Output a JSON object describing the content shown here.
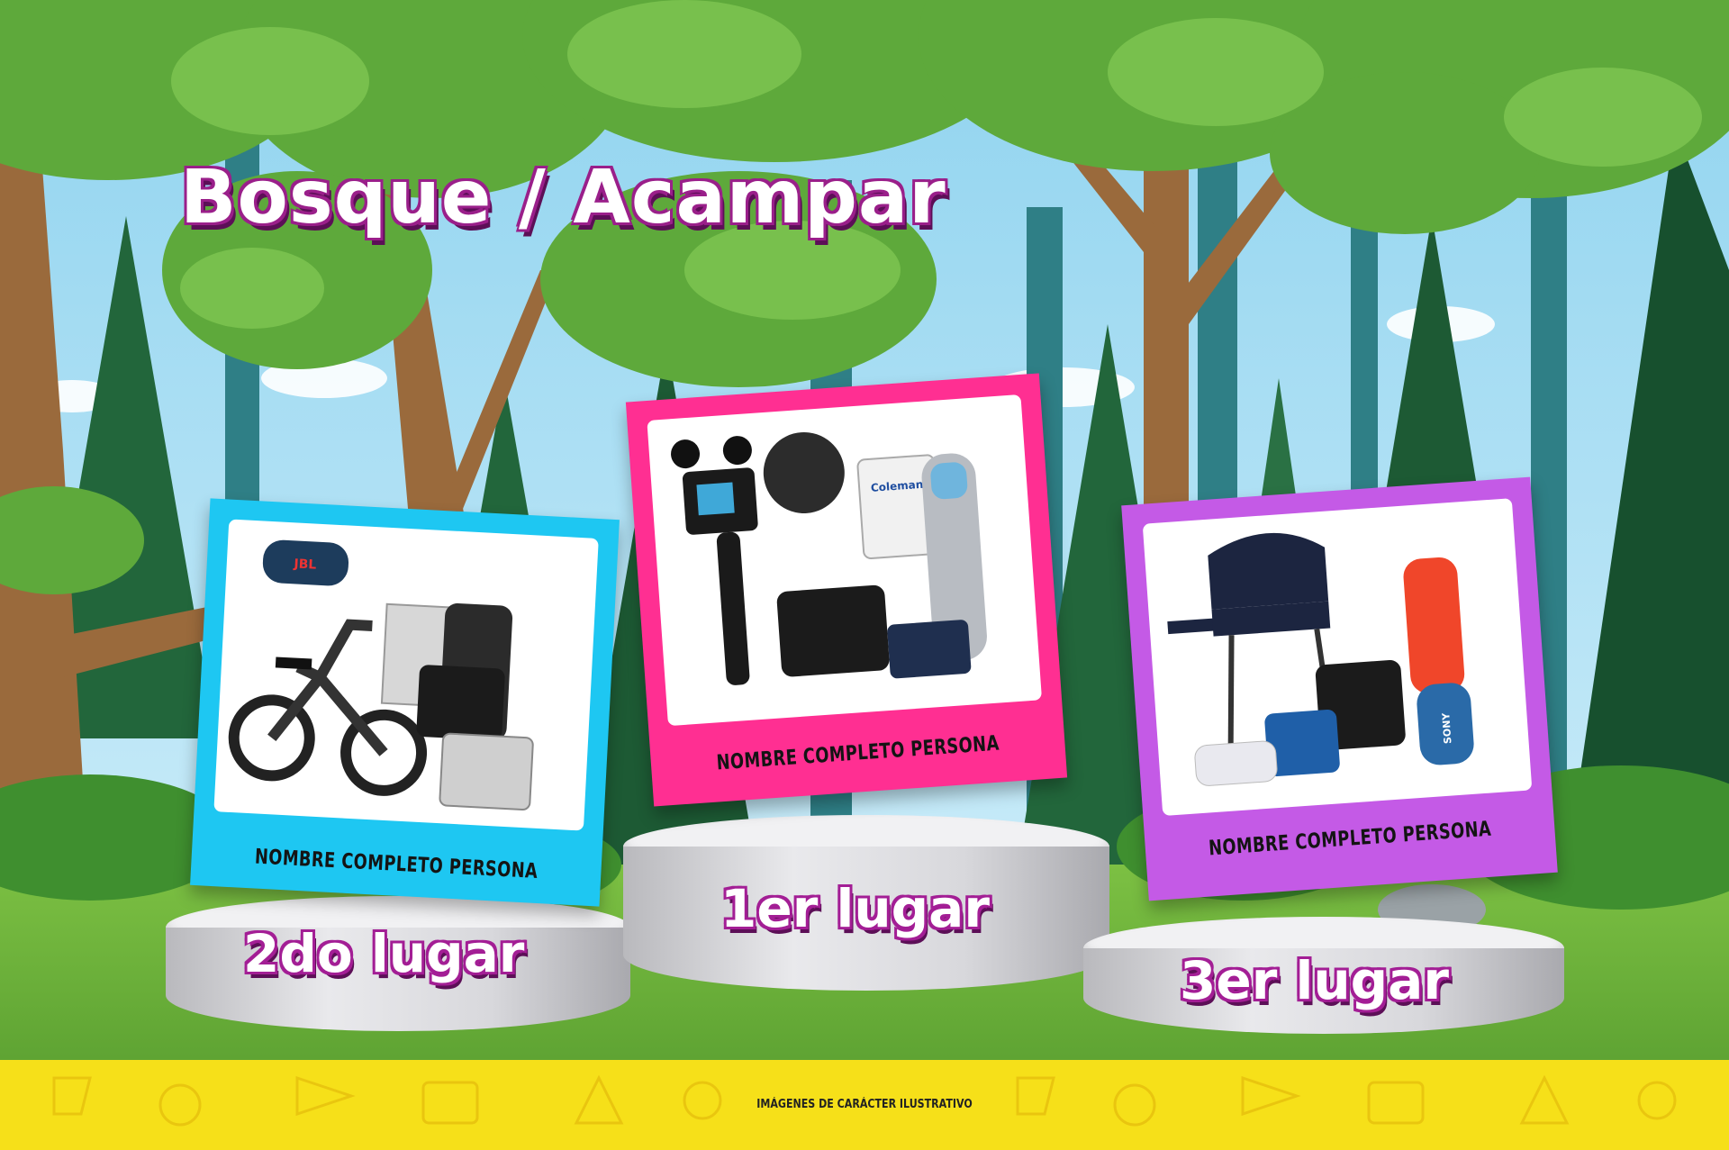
{
  "title": "Bosque / Acampar",
  "podiums": {
    "first": {
      "place": "1er lugar",
      "winner": "NOMBRE COMPLETO PERSONA",
      "color": "#ff2f92"
    },
    "second": {
      "place": "2do lugar",
      "winner": "NOMBRE COMPLETO PERSONA",
      "color": "#1ec7f2"
    },
    "third": {
      "place": "3er lugar",
      "winner": "NOMBRE COMPLETO PERSONA",
      "color": "#c45ae6"
    }
  },
  "product_text": {
    "speaker_brand": "JBL",
    "cooler_brand": "Coleman",
    "speaker2_brand": "SONY"
  },
  "footer": {
    "note": "IMÁGENES DE CARÁCTER ILUSTRATIVO",
    "color": "#f6e019"
  }
}
